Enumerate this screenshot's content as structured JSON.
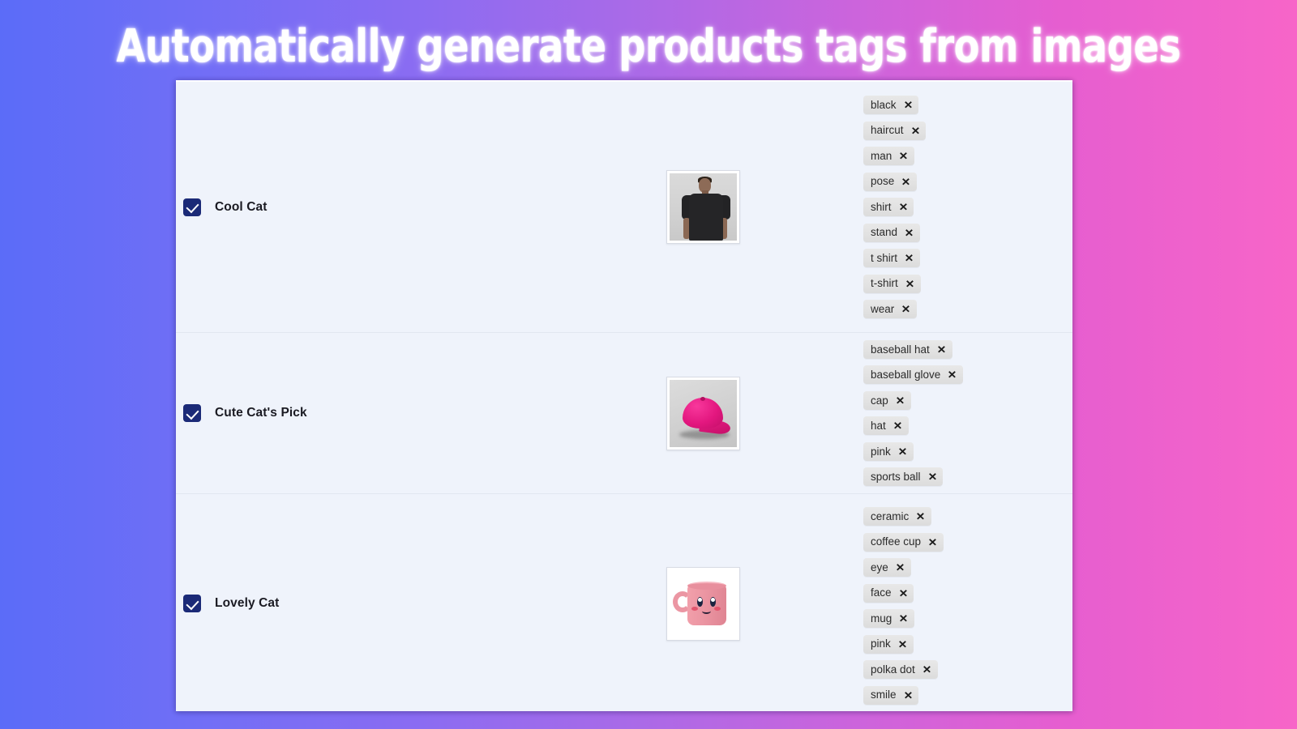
{
  "page": {
    "title": "Automatically generate products tags from images",
    "background_gradient_from": "#5b6cf8",
    "background_gradient_to": "#f765c8",
    "panel_background": "#eff3fb",
    "checkbox_color": "#1b2a77",
    "tag_chip_color": "#e3e3e3"
  },
  "products": [
    {
      "checked": true,
      "name": "Cool Cat",
      "image_alt": "man wearing black t-shirt",
      "tags": [
        {
          "label": "black",
          "remove": "✕"
        },
        {
          "label": "haircut",
          "remove": "✕"
        },
        {
          "label": "man",
          "remove": "✕"
        },
        {
          "label": "pose",
          "remove": "✕"
        },
        {
          "label": "shirt",
          "remove": "✕"
        },
        {
          "label": "stand",
          "remove": "✕"
        },
        {
          "label": "t shirt",
          "remove": "✕"
        },
        {
          "label": "t-shirt",
          "remove": "✕"
        },
        {
          "label": "wear",
          "remove": "✕"
        }
      ]
    },
    {
      "checked": true,
      "name": "Cute Cat's Pick",
      "image_alt": "pink baseball cap",
      "tags": [
        {
          "label": "baseball hat",
          "remove": "✕"
        },
        {
          "label": "baseball glove",
          "remove": "✕"
        },
        {
          "label": "cap",
          "remove": "✕"
        },
        {
          "label": "hat",
          "remove": "✕"
        },
        {
          "label": "pink",
          "remove": "✕"
        },
        {
          "label": "sports ball",
          "remove": "✕"
        }
      ]
    },
    {
      "checked": true,
      "name": "Lovely Cat",
      "image_alt": "pink ceramic mug with smiling face",
      "tags": [
        {
          "label": "ceramic",
          "remove": "✕"
        },
        {
          "label": "coffee cup",
          "remove": "✕"
        },
        {
          "label": "eye",
          "remove": "✕"
        },
        {
          "label": "face",
          "remove": "✕"
        },
        {
          "label": "mug",
          "remove": "✕"
        },
        {
          "label": "pink",
          "remove": "✕"
        },
        {
          "label": "polka dot",
          "remove": "✕"
        },
        {
          "label": "smile",
          "remove": "✕"
        }
      ]
    }
  ]
}
